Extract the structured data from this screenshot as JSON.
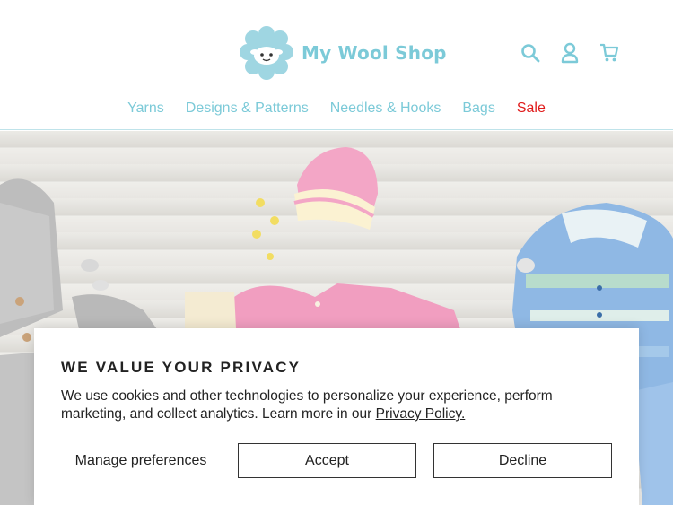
{
  "brand": {
    "name": "My Wool Shop",
    "accent": "#7ccad8",
    "sale_color": "#e01b1b"
  },
  "header": {
    "icons": [
      "search-icon",
      "account-icon",
      "cart-icon"
    ]
  },
  "nav": {
    "items": [
      {
        "label": "Yarns"
      },
      {
        "label": "Designs & Patterns"
      },
      {
        "label": "Needles & Hooks"
      },
      {
        "label": "Bags"
      },
      {
        "label": "Sale"
      }
    ]
  },
  "cookie": {
    "title": "WE VALUE YOUR PRIVACY",
    "text": "We use cookies and other technologies to personalize your experience, perform marketing, and collect analytics. Learn more in our ",
    "policy_link": "Privacy Policy.",
    "manage_label": "Manage preferences",
    "accept_label": "Accept",
    "decline_label": "Decline"
  }
}
